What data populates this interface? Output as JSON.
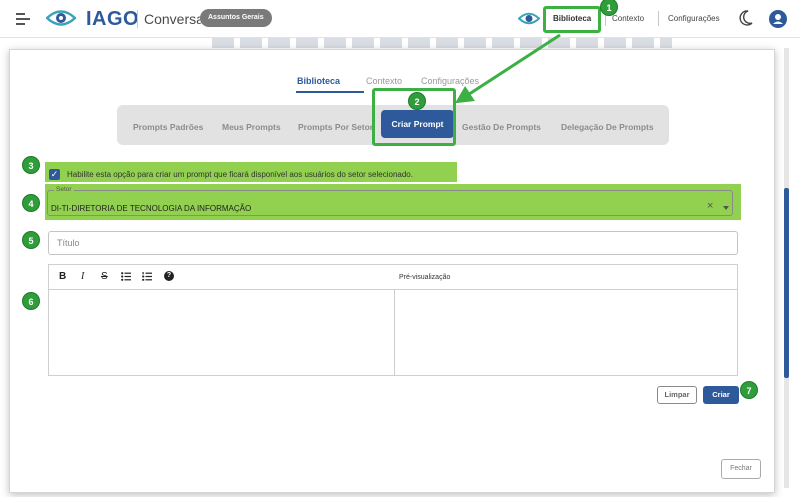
{
  "appbar": {
    "brand": "IAGO",
    "conversa": "Conversa",
    "pill": "Assuntos Gerais",
    "nav": [
      "Biblioteca",
      "Contexto",
      "Configurações"
    ],
    "icons": [
      "hamburger-icon",
      "iago-eye-logo",
      "eye-icon",
      "moon-icon",
      "user-avatar-icon"
    ]
  },
  "modal": {
    "tabs": [
      "Biblioteca",
      "Contexto",
      "Configurações"
    ],
    "active_tab": "Biblioteca",
    "subtabs": [
      "Prompts Padrões",
      "Meus Prompts",
      "Prompts Por Setor",
      "Criar Prompt",
      "Gestão De Prompts",
      "Delegação De Prompts"
    ],
    "active_subtab": "Criar Prompt",
    "checkbox_label": "Habilite esta opção para criar um prompt que ficará disponível aos usuários do setor selecionado.",
    "checkbox_checked": true,
    "setor_label": "Setor",
    "setor_value": "DI-TI-DIRETORIA DE TECNOLOGIA DA INFORMAÇÃO",
    "titulo_placeholder": "Título",
    "toolbar": [
      "B",
      "I",
      "S",
      "bulleted-list-icon",
      "numbered-list-icon",
      "help-icon"
    ],
    "preview_label": "Pré-visualização",
    "limpar": "Limpar",
    "criar": "Criar",
    "fechar": "Fechar"
  },
  "callouts": [
    "1",
    "2",
    "3",
    "4",
    "5",
    "6",
    "7"
  ],
  "colors": {
    "primary": "#2e5a9c",
    "highlight": "#92d050",
    "callout": "#2e9d3a"
  }
}
